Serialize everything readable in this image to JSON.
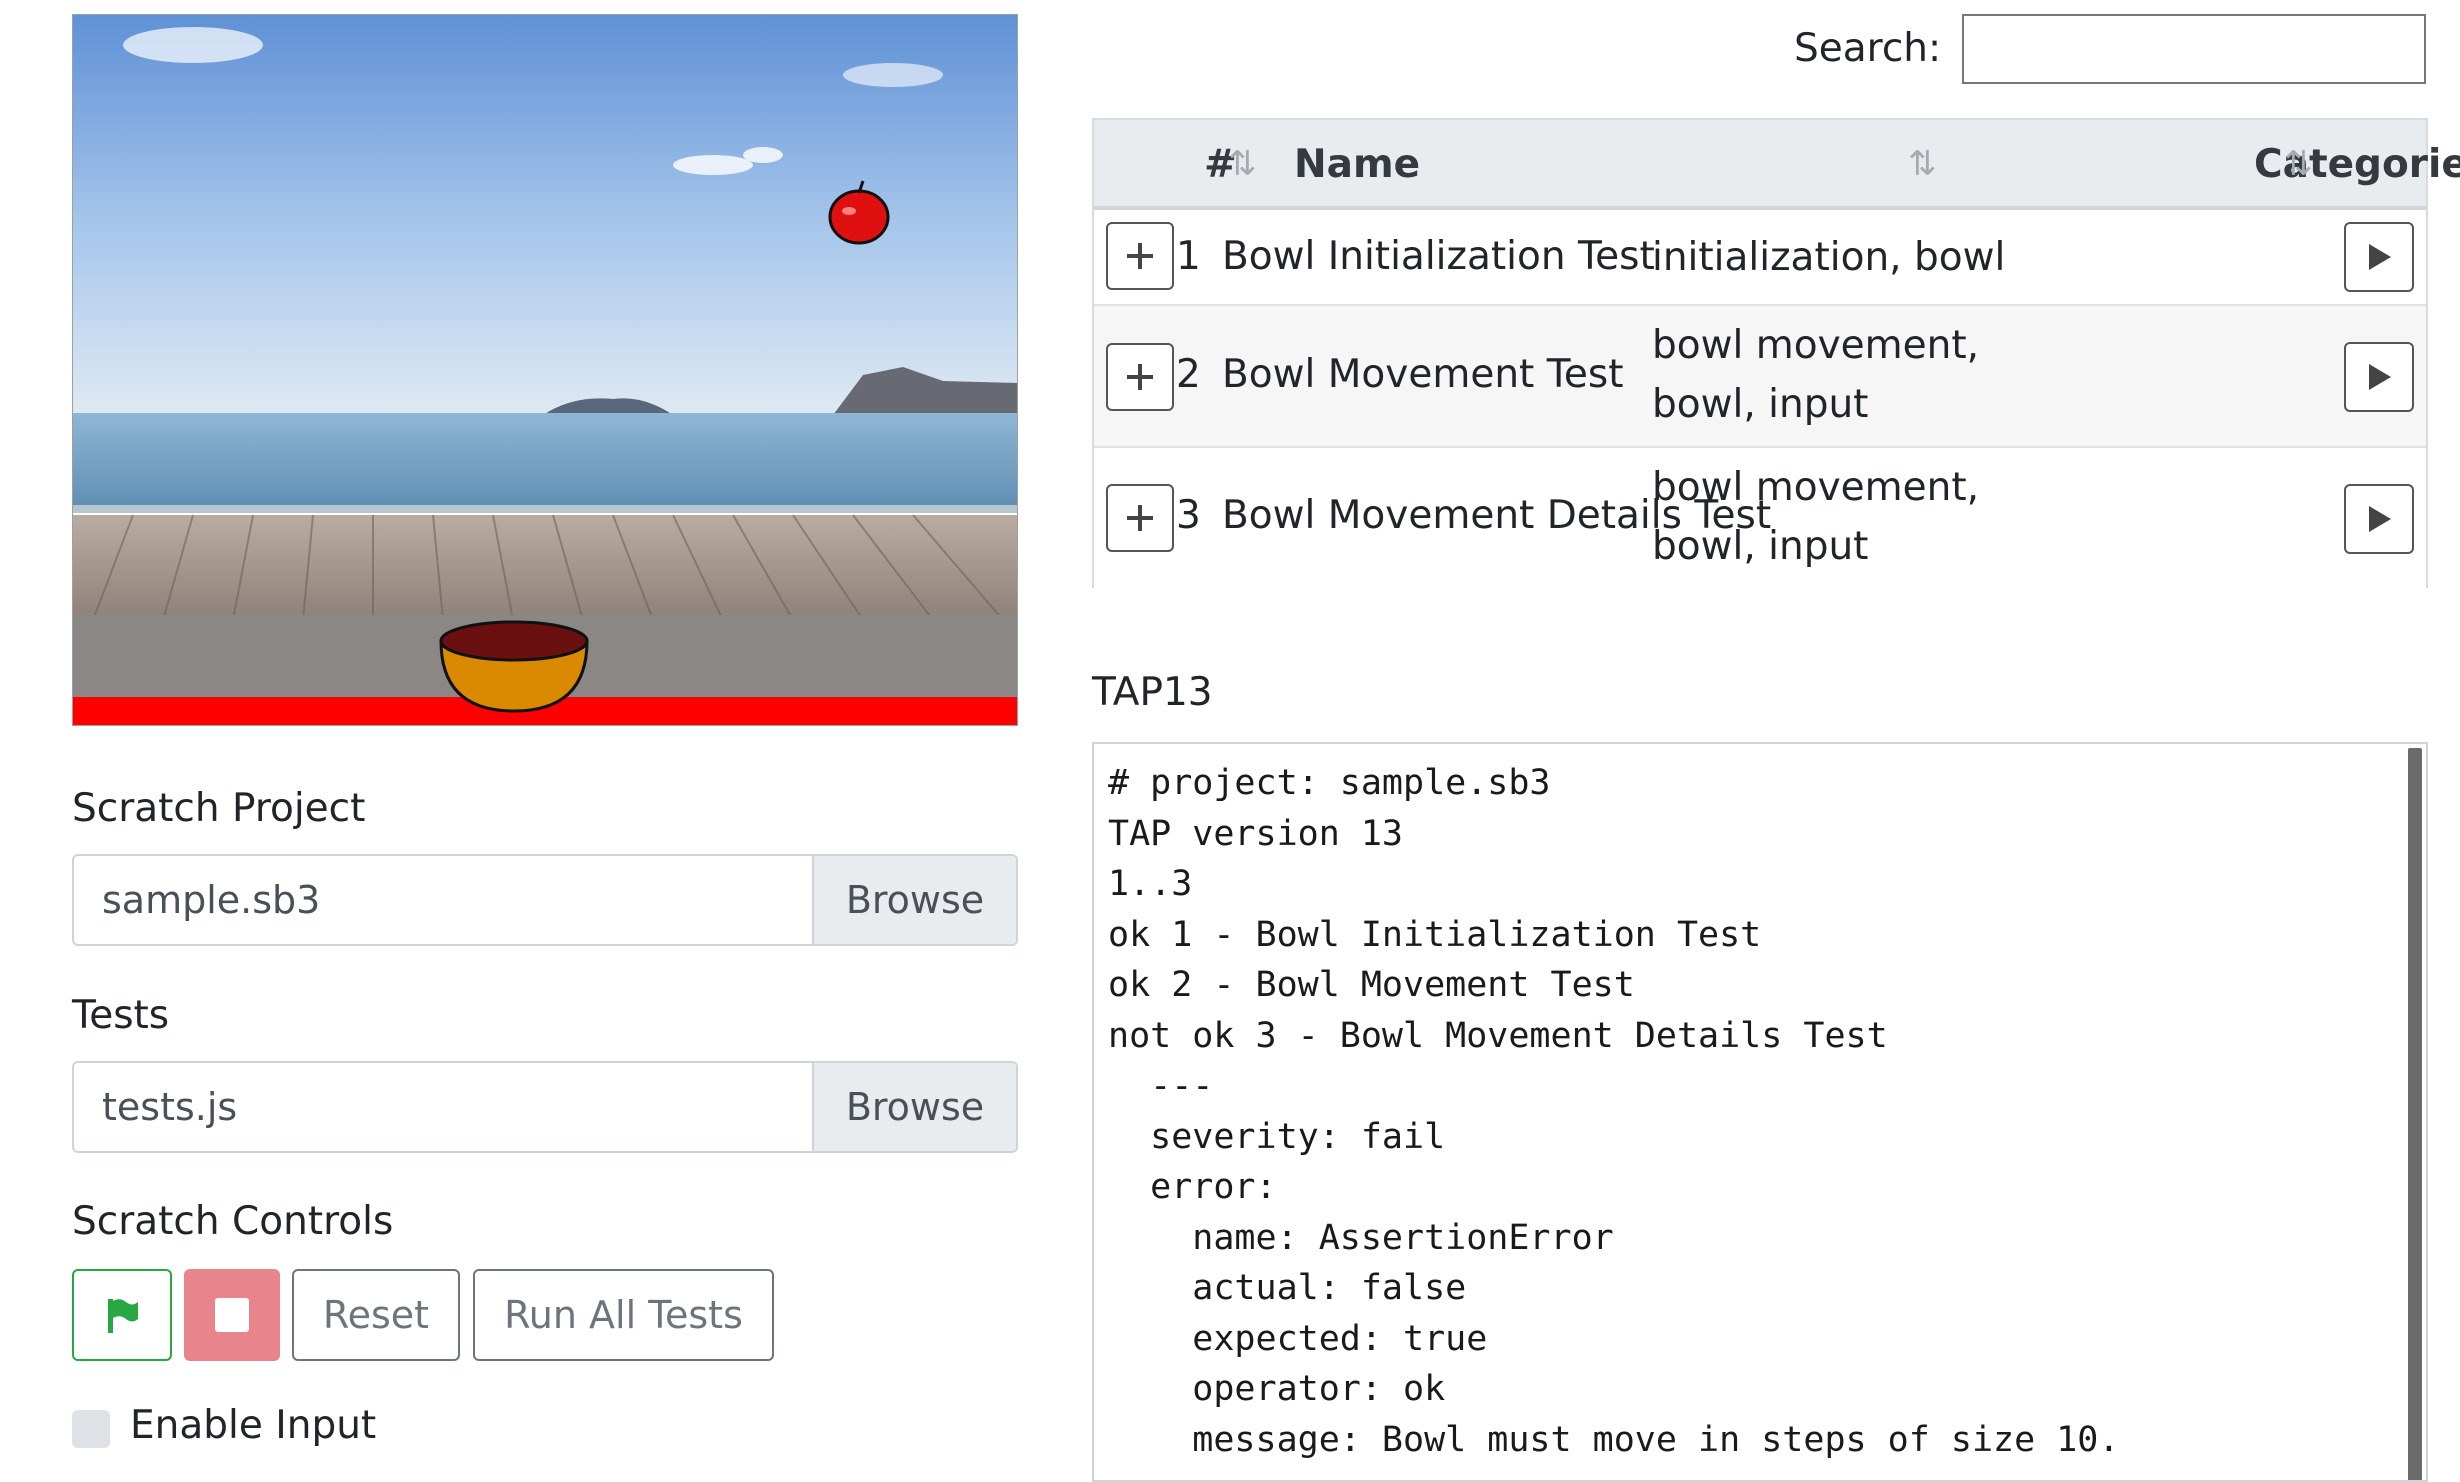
{
  "project": {
    "section_label": "Scratch Project",
    "file_name": "sample.sb3",
    "browse_label": "Browse"
  },
  "tests": {
    "section_label": "Tests",
    "file_name": "tests.js",
    "browse_label": "Browse"
  },
  "controls": {
    "section_label": "Scratch Controls",
    "flag_icon": "green-flag-icon",
    "stop_icon": "stop-icon",
    "reset_label": "Reset",
    "run_all_label": "Run All Tests",
    "enable_input_label": "Enable Input",
    "colors": {
      "flag": "#28a745",
      "stop": "#e8848b"
    }
  },
  "search": {
    "label": "Search:",
    "value": ""
  },
  "table": {
    "headers": {
      "num": "#",
      "name": "Name",
      "categories": "Categories"
    },
    "rows": [
      {
        "num": "1",
        "name": "Bowl Initialization Test",
        "categories": [
          "initialization, bowl"
        ]
      },
      {
        "num": "2",
        "name": "Bowl Movement Test",
        "categories": [
          "bowl movement,",
          "bowl, input"
        ]
      },
      {
        "num": "3",
        "name": "Bowl Movement Details Test",
        "categories": [
          "bowl movement,",
          "bowl, input"
        ]
      }
    ]
  },
  "tap": {
    "title": "TAP13",
    "lines": [
      "# project: sample.sb3",
      "TAP version 13",
      "1..3",
      "ok 1 - Bowl Initialization Test",
      "ok 2 - Bowl Movement Test",
      "not ok 3 - Bowl Movement Details Test",
      "  ---",
      "  severity: fail",
      "  error:",
      "    name: AssertionError",
      "    actual: false",
      "    expected: true",
      "    operator: ok",
      "    message: Bowl must move in steps of size 10."
    ]
  }
}
